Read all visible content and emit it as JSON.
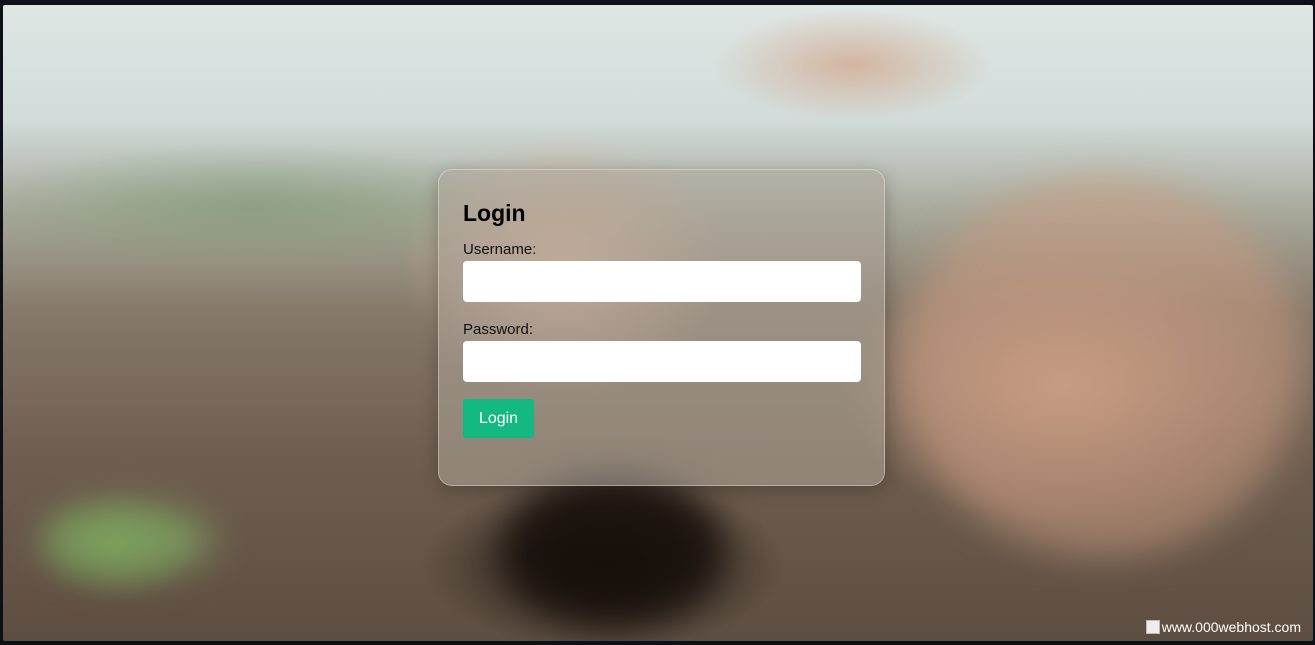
{
  "login_form": {
    "title": "Login",
    "username_label": "Username:",
    "username_value": "",
    "password_label": "Password:",
    "password_value": "",
    "submit_label": "Login"
  },
  "footer": {
    "host_link_text": "www.000webhost.com"
  },
  "colors": {
    "button": "#14b881",
    "page_frame": "#0d1117"
  }
}
